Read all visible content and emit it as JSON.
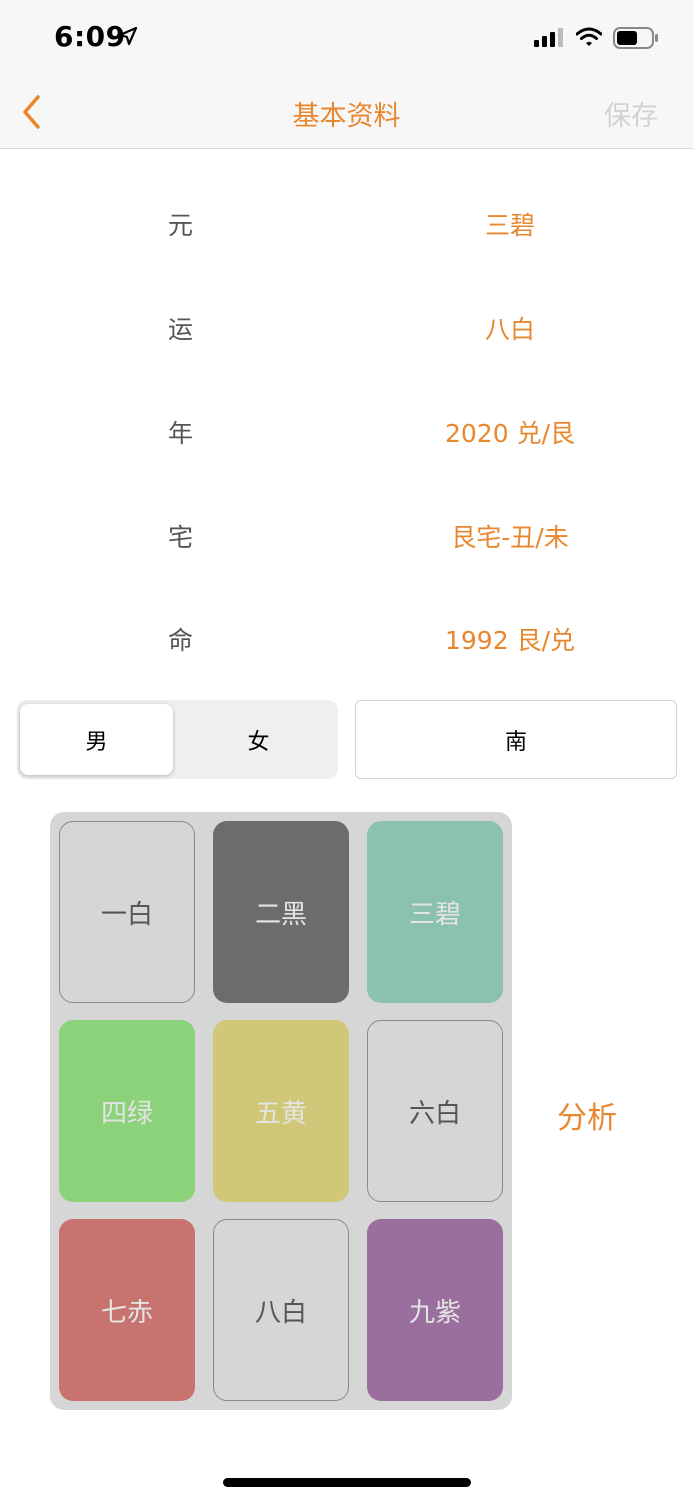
{
  "status_bar": {
    "time": "6:09"
  },
  "nav": {
    "title": "基本资料",
    "save_label": "保存"
  },
  "info_rows": [
    {
      "label": "元",
      "value": "三碧"
    },
    {
      "label": "运",
      "value": "八白"
    },
    {
      "label": "年",
      "value": "2020 兑/艮"
    },
    {
      "label": "宅",
      "value": "艮宅-丑/未"
    },
    {
      "label": "命",
      "value": "1992 艮/兑"
    }
  ],
  "gender": {
    "options": [
      "男",
      "女"
    ],
    "selected": "男"
  },
  "direction": {
    "value": "南"
  },
  "stars": [
    {
      "label": "一白",
      "bg": "#d6d6d6",
      "text": "#555555",
      "outlined": true
    },
    {
      "label": "二黑",
      "bg": "#6c6c6c",
      "text": "#e4e4e4",
      "outlined": false
    },
    {
      "label": "三碧",
      "bg": "#8ac1b1",
      "text": "#e4e4e4",
      "outlined": false
    },
    {
      "label": "四绿",
      "bg": "#8bd27a",
      "text": "#e4e4e4",
      "outlined": false
    },
    {
      "label": "五黄",
      "bg": "#d1c778",
      "text": "#e4e4e4",
      "outlined": false
    },
    {
      "label": "六白",
      "bg": "#d6d6d6",
      "text": "#555555",
      "outlined": true
    },
    {
      "label": "七赤",
      "bg": "#c8736f",
      "text": "#e4e4e4",
      "outlined": false
    },
    {
      "label": "八白",
      "bg": "#d6d6d6",
      "text": "#555555",
      "outlined": true
    },
    {
      "label": "九紫",
      "bg": "#9a6f9e",
      "text": "#e4e4e4",
      "outlined": false
    }
  ],
  "analyze_label": "分析",
  "colors": {
    "accent": "#e8872e"
  }
}
